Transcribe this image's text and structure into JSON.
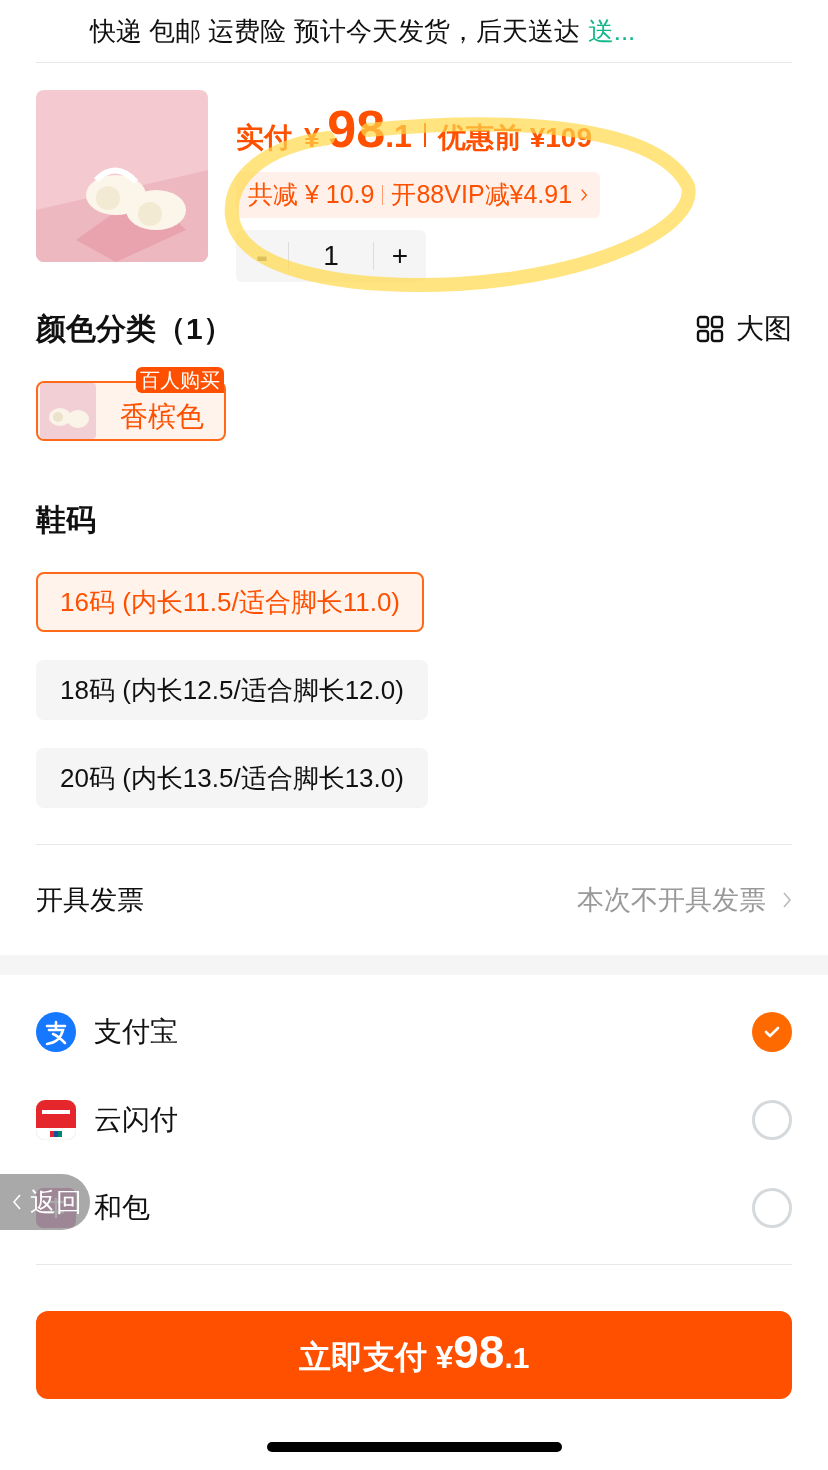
{
  "shipping": {
    "text": "快递 包邮 运费险 预计今天发货，后天送达",
    "link": "送..."
  },
  "product": {
    "paid_label": "实付",
    "currency": "¥",
    "amount_int": "98",
    "amount_dec": ".1",
    "original_price": "优惠前 ¥109",
    "discount": "共减 ¥ 10.9",
    "vip_offer": "开88VIP减¥4.91",
    "quantity": {
      "minus": "-",
      "value": "1",
      "plus": "+",
      "minus_disabled": true
    }
  },
  "color_section": {
    "title": "颜色分类（1）",
    "view_toggle": "大图",
    "options": [
      {
        "label": "香槟色",
        "badge": "百人购买",
        "selected": true
      }
    ]
  },
  "size_section": {
    "title": "鞋码",
    "options": [
      {
        "label": "16码 (内长11.5/适合脚长11.0)",
        "selected": true
      },
      {
        "label": "18码 (内长12.5/适合脚长12.0)",
        "selected": false
      },
      {
        "label": "20码 (内长13.5/适合脚长13.0)",
        "selected": false
      }
    ]
  },
  "invoice": {
    "label": "开具发票",
    "value": "本次不开具发票"
  },
  "payment_methods": [
    {
      "kind": "alipay",
      "name": "支付宝",
      "selected": true
    },
    {
      "kind": "unionpay",
      "name": "云闪付",
      "selected": false
    },
    {
      "kind": "hebao",
      "name": "和包",
      "selected": false
    }
  ],
  "back_button": {
    "label": "返回"
  },
  "pay_button": {
    "label": "立即支付",
    "currency": "¥",
    "amount_int": "98",
    "amount_dec": ".1"
  }
}
